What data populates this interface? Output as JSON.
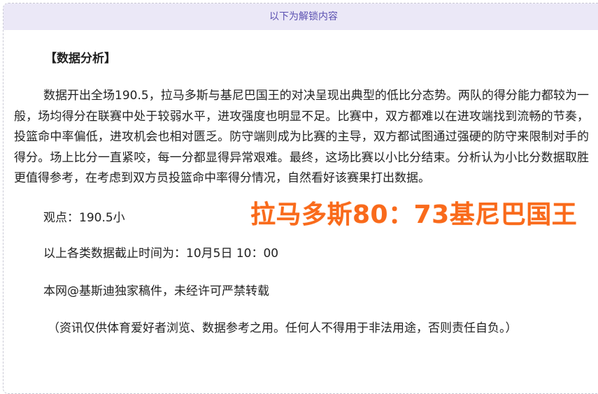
{
  "unlock_banner": "以下为解锁内容",
  "article": {
    "section_title": "【数据分析】",
    "analysis": "数据开出全场190.5，拉马多斯与基尼巴国王的对决呈现出典型的低比分态势。两队的得分能力都较为一般，场均得分在联赛中处于较弱水平，进攻强度也明显不足。比赛中，双方都难以在进攻端找到流畅的节奏，投篮命中率偏低，进攻机会也相对匮乏。防守端则成为比赛的主导，双方都试图通过强硬的防守来限制对手的得分。场上比分一直紧咬，每一分都显得异常艰难。最终，这场比赛以小比分结束。分析认为小比分数据取胜更值得参考，在考虑到双方员投篮命中率得分情况，自然看好该赛果打出数据。",
    "viewpoint": "观点：190.5小",
    "cutoff_time": "以上各类数据截止时间为：10月5日 10：00",
    "copyright": "本网@基斯迪独家稿件，未经许可严禁转载",
    "disclaimer": "（资讯仅供体育爱好者浏览、数据参考之用。任何人不得用于非法用途，否则责任自负。）"
  },
  "score_overlay": {
    "text": "拉马多斯80：73基尼巴国王",
    "color": "#f96a1b"
  }
}
